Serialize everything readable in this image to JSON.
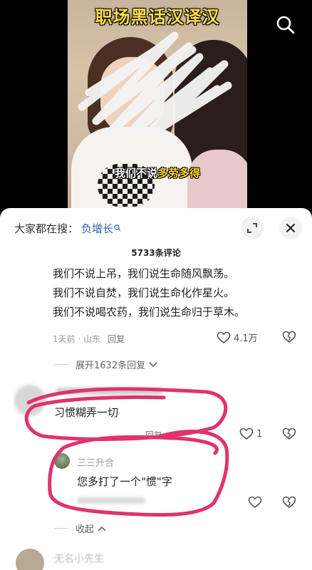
{
  "video": {
    "title": "职场黑话汉译汉",
    "subtitle_pre": "我们不说",
    "subtitle_hl": "多劳多得"
  },
  "comments": {
    "search_prefix": "大家都在搜：",
    "search_term": "负增长",
    "count": "5733条评论",
    "top": {
      "lines": [
        "我们不说上吊，我们说生命随风飘荡。",
        "我们不说自焚，我们说生命化作星火。",
        "我们不说喝农药，我们说生命归于草木。"
      ],
      "time_loc": "1天前 · 山东",
      "reply": "回复",
      "likes": "4.1万",
      "expand": "展开1632条回复"
    },
    "second": {
      "text": "习惯糊弄一切",
      "reply": "回复",
      "likes": "1",
      "sub": {
        "name": "三三升合",
        "text": "您多打了一个\"惯\"字"
      }
    },
    "collapse": "收起",
    "next_name": "无名小先生"
  },
  "colors": {
    "title_yellow": "#ffe14a",
    "link_blue": "#2f5fa8",
    "annotation_pink": "#e0336e"
  }
}
